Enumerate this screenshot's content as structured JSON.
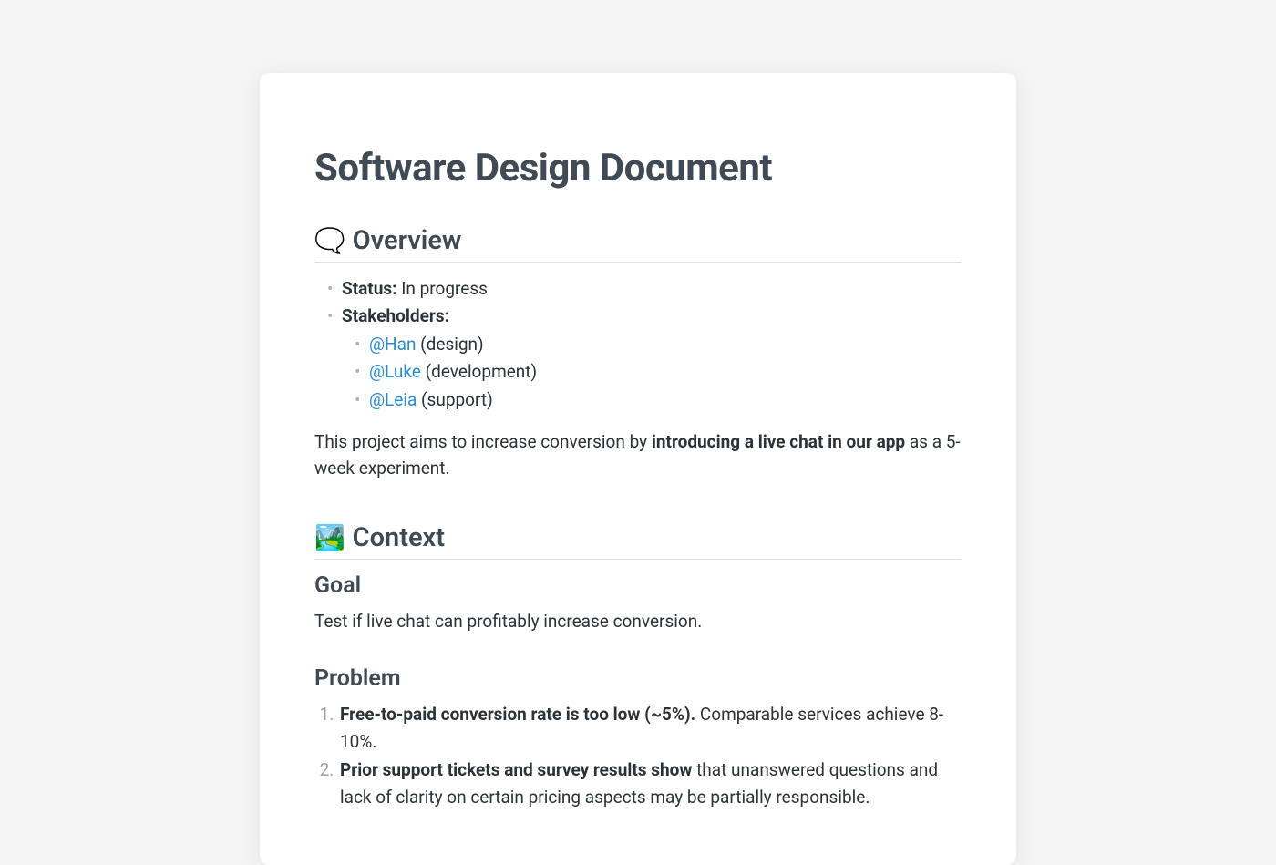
{
  "title": "Software Design Document",
  "overview": {
    "icon": "🗨️",
    "heading": "Overview",
    "status_label": "Status:",
    "status_value": "In progress",
    "stakeholders_label": "Stakeholders:",
    "stakeholders": [
      {
        "mention": "@Han",
        "role": "(design)"
      },
      {
        "mention": "@Luke",
        "role": "(development)"
      },
      {
        "mention": "@Leia",
        "role": "(support)"
      }
    ],
    "summary_pre": "This project aims to increase conversion by ",
    "summary_bold": "introducing a live chat in our app",
    "summary_post": " as a 5-week experiment."
  },
  "context": {
    "icon": "🏞️",
    "heading": "Context",
    "goal_heading": "Goal",
    "goal_text": "Test if live chat can profitably increase conversion.",
    "problem_heading": "Problem",
    "problems": [
      {
        "bold": "Free-to-paid conversion rate is too low (~5%).",
        "rest": " Comparable services achieve 8-10%."
      },
      {
        "bold": "Prior support tickets and survey results show",
        "rest": " that unanswered questions and lack of clarity on certain pricing aspects may be partially responsible."
      }
    ]
  }
}
